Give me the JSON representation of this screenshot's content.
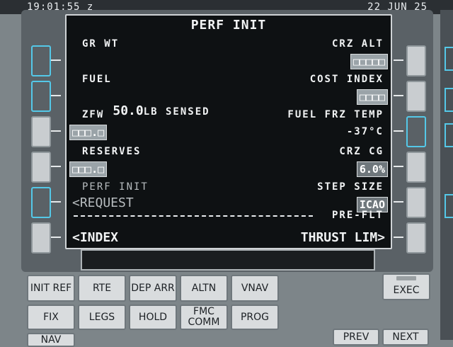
{
  "status": {
    "time": "19:01:55 z",
    "date": "22 JUN 25"
  },
  "screen": {
    "title": "PERF INIT",
    "gr_wt_label": "GR WT",
    "crz_alt_label": "CRZ ALT",
    "crz_alt_value": "□□□□□",
    "fuel_label": "FUEL",
    "fuel_value": "50.0",
    "fuel_suffix": "LB SENSED",
    "cost_index_label": "COST INDEX",
    "cost_index_value": "□□□□",
    "zfw_label": "ZFW",
    "zfw_value": "□□□.□",
    "fuel_frz_temp_label": "FUEL FRZ TEMP",
    "fuel_frz_temp_value": "-37°C",
    "reserves_label": "RESERVES",
    "reserves_value": "□□□.□",
    "crz_cg_label": "CRZ CG",
    "crz_cg_value": "6.0%",
    "perf_init_label": "PERF INIT",
    "request_label": "<REQUEST",
    "step_size_label": "STEP SIZE",
    "step_size_value": "ICAO",
    "pre_flt_label": "PRE-FLT",
    "index_label": "<INDEX",
    "thrust_lim_label": "THRUST LIM>"
  },
  "keys": {
    "init_ref": "INIT REF",
    "rte": "RTE",
    "dep_arr": "DEP ARR",
    "altn": "ALTN",
    "vnav": "VNAV",
    "fix": "FIX",
    "legs": "LEGS",
    "hold": "HOLD",
    "fmc_comm": "FMC COMM",
    "prog": "PROG",
    "exec": "EXEC",
    "nav": "NAV",
    "prev": "PREV",
    "next": "NEXT"
  },
  "colors": {
    "lsk_highlight": "#54c8e8",
    "screen_bg": "#0e1113",
    "input_box": "#9aa3a8"
  }
}
